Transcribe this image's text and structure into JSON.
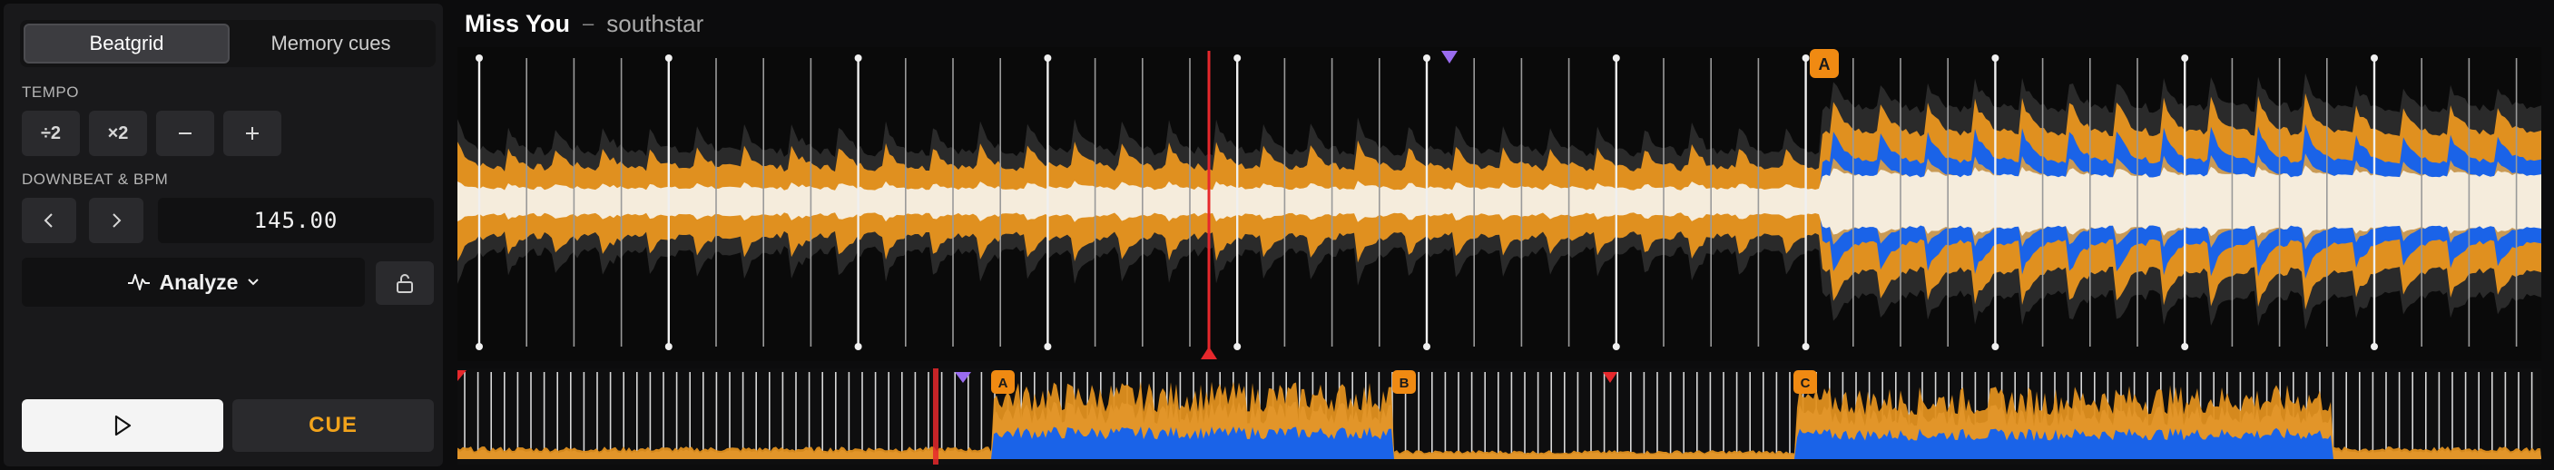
{
  "panel": {
    "tabs": [
      {
        "label": "Beatgrid",
        "active": true
      },
      {
        "label": "Memory cues",
        "active": false
      }
    ],
    "tempo_label": "TEMPO",
    "tempo_buttons": [
      "÷2",
      "×2"
    ],
    "downbeat_label": "DOWNBEAT & BPM",
    "bpm_value": "145.00",
    "analyze_label": "Analyze",
    "cue_label": "CUE"
  },
  "track": {
    "title": "Miss You",
    "separator": "–",
    "artist": "southstar"
  },
  "colors": {
    "orange": "#e0901f",
    "blue": "#1a63e8",
    "cream": "#f5ecdc",
    "playhead": "#e6282c",
    "purple_marker": "#9a6cf0",
    "cue_badge": "#f08a12"
  },
  "hot_cues": {
    "main": [
      {
        "label": "A"
      }
    ],
    "overview": [
      {
        "label": "A"
      },
      {
        "label": "B"
      },
      {
        "label": "C"
      }
    ]
  }
}
